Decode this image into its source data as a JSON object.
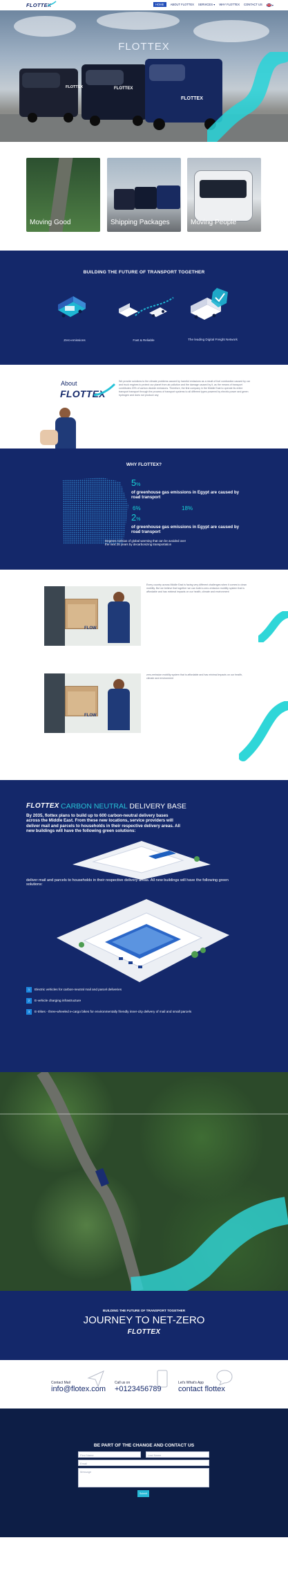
{
  "brand": {
    "name": "FLOTTEX",
    "accent": "#27c3d8",
    "navy": "#14286a"
  },
  "nav": {
    "items": [
      "HOME",
      "ABOUT FLOTTEX",
      "SERVICES",
      "WHY FLOTTEX",
      "CONTACT US"
    ],
    "active": "HOME",
    "services_caret": "▾",
    "lang_icon": "flag-uk-icon"
  },
  "hero": {
    "title": "FLOTTEX",
    "van_brand": "FLOTTEX"
  },
  "cards": [
    {
      "label": "Moving Good"
    },
    {
      "label": "Shipping Packages"
    },
    {
      "label": "Moving People"
    }
  ],
  "build": {
    "title": "BUILDING THE FUTURE OF TRANSPORT TOGETHER",
    "features": [
      {
        "label": "Zero-emissions"
      },
      {
        "label": "Fast & Reliable"
      },
      {
        "label": "The leading Digital Freight Network"
      }
    ]
  },
  "about": {
    "heading": "About",
    "logo": "FLOTTEX",
    "text": "We provide solutions to the climate problems caused by harmful emissions as a result of fuel combustion caused by car and truck engines to protect our planet from air pollution and the damage caused by it, as the means of transport contributes 20% of carbon dioxide emissions. Therefore, the first company in the Middle East to operate its entire transport transport through the process of transport systems to all different types powered by electric power and green hydrogen and does not produce any"
  },
  "why": {
    "title": "WHY FLOTTEX?",
    "stats": [
      {
        "value": "5",
        "unit": "%",
        "text": "of greenhouse gas emissions in Egypt are caused by road transport"
      },
      {
        "value": "6%",
        "text": ""
      },
      {
        "value": "18%",
        "text": ""
      },
      {
        "value": "2",
        "unit": "%",
        "text": "of greenhouse gas emissions in Egypt are caused by road transport"
      }
    ],
    "caption": "Degrees Celsius of global warming that can be avoided over the next 25 years by decarbonizing transportation"
  },
  "story": {
    "text1": "Every country across Middle East is facing very different challenges when it comes to clean mobility. But we believe that together we can build a zero-emission mobility system that is affordable and has minimal impacts on our health, climate and environment",
    "text2": "zero-emission mobility system that is affordable and has minimal impacts on our health, climate and environment",
    "box_label": "FLOW"
  },
  "delivery": {
    "logo": "FLOTTEX",
    "title_accent": "CARBON NEUTRAL",
    "title_rest": "DELIVERY BASE",
    "paragraph": "By 2035, flottex plans to build up to 600 carbon-neutral delivery bases across the Middle East. From these new locations, service providers will deliver mail and parcels to households in their respective delivery areas. All new buildings will have the following green solutions:",
    "paragraph_repeat": "deliver mail and parcels to households in their respective delivery areas. All new buildings will have the following green solutions:",
    "items": [
      {
        "num": "1",
        "text": "Electric vehicles for carbon-neutral mail and parcel deliveries"
      },
      {
        "num": "2",
        "text": "E-vehicle charging infrastructure"
      },
      {
        "num": "3",
        "text": "E-trikes - three-wheeled e-cargo bikes for environmentally friendly inner-city delivery of mail and small parcels"
      }
    ]
  },
  "netzero": {
    "kicker": "BUILDING THE FUTURE OF TRANSPORT TOGETHER",
    "title": "JOURNEY TO NET-ZERO",
    "logo": "FLOTTEX"
  },
  "contact_info": [
    {
      "label": "Contact Mail",
      "value": "info@flotex.com",
      "icon": "paper-plane-icon"
    },
    {
      "label": "Call us on",
      "value": "+0123456789",
      "icon": "phone-icon"
    },
    {
      "label": "Let's What's App",
      "value": "contact flottex",
      "icon": "chat-bubble-icon"
    }
  ],
  "form": {
    "title": "BE PART OF THE CHANGE AND CONTACT US",
    "first_name": "First Name",
    "last_name": "Last Name",
    "email": "Email",
    "message": "Message",
    "submit": "Submit"
  }
}
